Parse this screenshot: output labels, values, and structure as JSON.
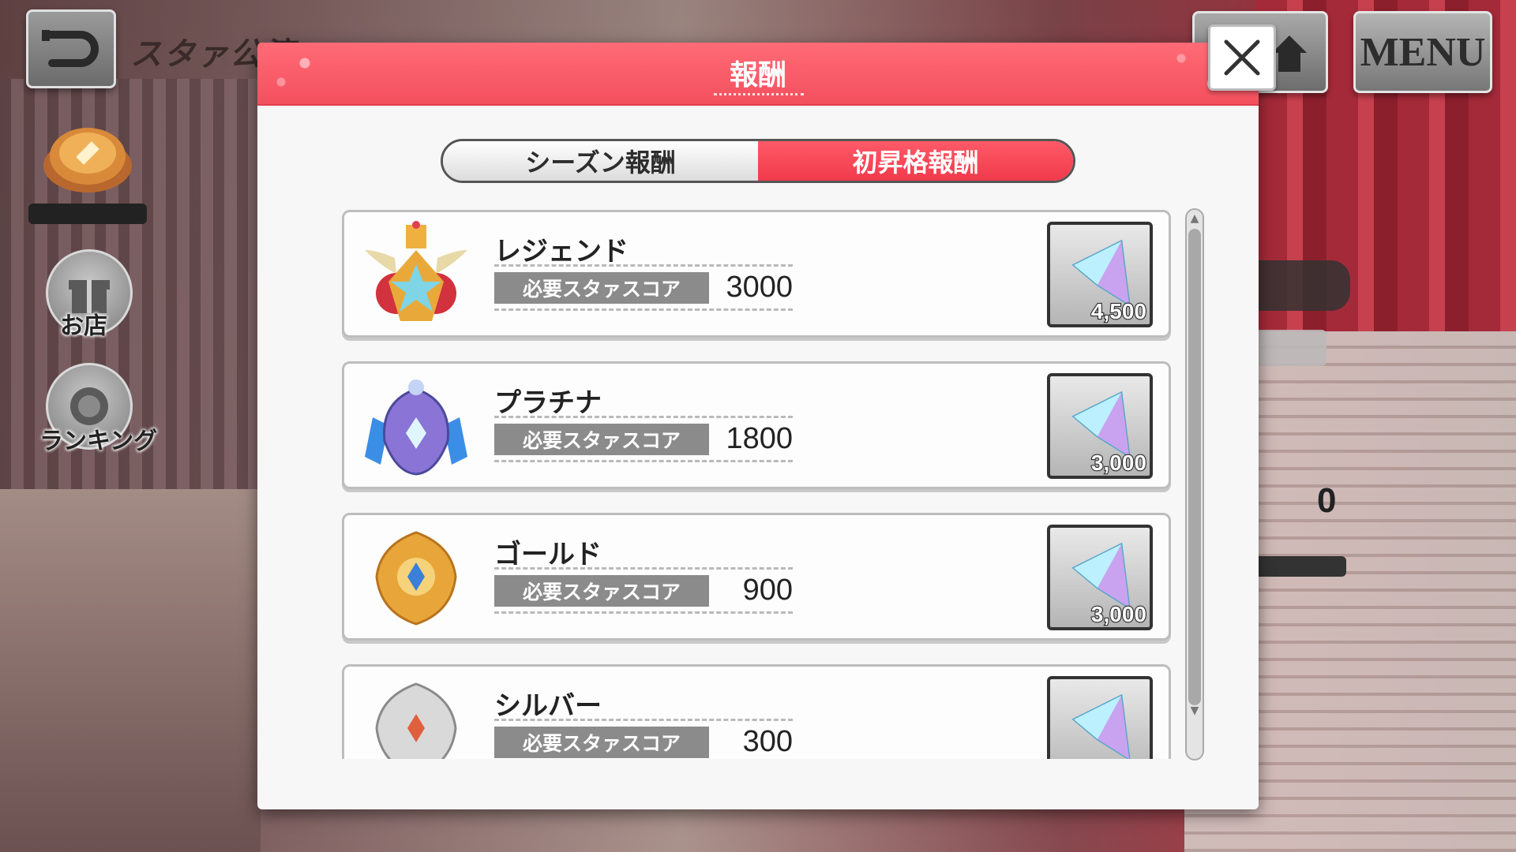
{
  "header": {
    "title": "スタァ公演",
    "menu_label": "MENU"
  },
  "side": {
    "shop_label": "お店",
    "ranking_label": "ランキング"
  },
  "background": {
    "counter_value": "0"
  },
  "modal": {
    "title": "報酬",
    "tabs": [
      {
        "label": "シーズン報酬",
        "active": false
      },
      {
        "label": "初昇格報酬",
        "active": true
      }
    ],
    "rewards": [
      {
        "rank": "レジェンド",
        "score_label": "必要スタァスコア",
        "score": "3000",
        "reward_count": "4,500",
        "emblem": "legend-emblem-icon"
      },
      {
        "rank": "プラチナ",
        "score_label": "必要スタァスコア",
        "score": "1800",
        "reward_count": "3,000",
        "emblem": "platinum-emblem-icon"
      },
      {
        "rank": "ゴールド",
        "score_label": "必要スタァスコア",
        "score": "900",
        "reward_count": "3,000",
        "emblem": "gold-emblem-icon"
      },
      {
        "rank": "シルバー",
        "score_label": "必要スタァスコア",
        "score": "300",
        "reward_count": "",
        "emblem": "silver-emblem-icon"
      }
    ]
  },
  "colors": {
    "accent_red": "#f4505e",
    "tab_active": "#f03a4b"
  }
}
